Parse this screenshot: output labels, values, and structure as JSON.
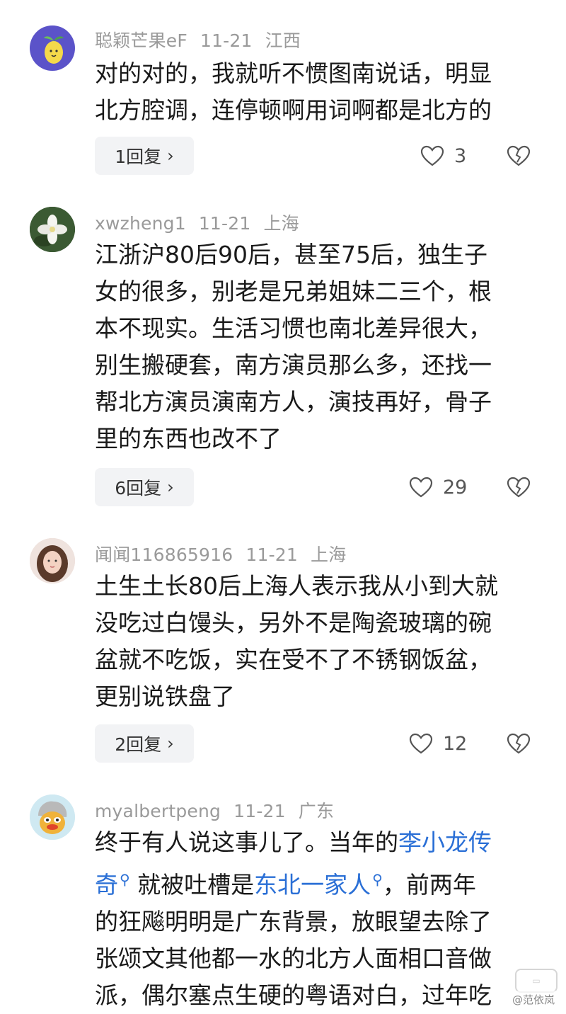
{
  "comments": [
    {
      "username": "聪颖芒果eF",
      "date": "11-21",
      "location": "江西",
      "lines": [
        "对的对的，我就听不惯图南说话，明显",
        "北方腔调，连停顿啊用词啊都是北方的"
      ],
      "reply_label": "1回复",
      "likes": "3"
    },
    {
      "username": "xwzheng1",
      "date": "11-21",
      "location": "上海",
      "lines": [
        "江浙沪80后90后，甚至75后，独生子",
        "女的很多，别老是兄弟姐妹二三个，根",
        "本不现实。生活习惯也南北差异很大，",
        "别生搬硬套，南方演员那么多，还找一",
        "帮北方演员演南方人，演技再好，骨子",
        "里的东西也改不了"
      ],
      "reply_label": "6回复",
      "likes": "29"
    },
    {
      "username": "闻闻116865916",
      "date": "11-21",
      "location": "上海",
      "lines": [
        "土生土长80后上海人表示我从小到大就",
        "没吃过白馒头，另外不是陶瓷玻璃的碗",
        "盆就不吃饭，实在受不了不锈钢饭盆，",
        "更别说铁盘了"
      ],
      "reply_label": "2回复",
      "likes": "12"
    },
    {
      "username": "myalbertpeng",
      "date": "11-21",
      "location": "广东",
      "line1_pre": "终于有人说这事儿了。当年的",
      "link1a": "李小龙传",
      "link1b": "奇",
      "line2_pre": "就被吐槽是",
      "link2": "东北一家人",
      "line2_post": "，前两年",
      "lines_rest": [
        "的狂飚明明是广东背景，放眼望去除了",
        "张颂文其他都一水的北方人面相口音做",
        "派，偶尔塞点生硬的粤语对白，过年吃"
      ]
    }
  ],
  "watermark": "@范依岚",
  "colors": {
    "link": "#2a6fd6",
    "meta": "#9a9a9a",
    "reply_bg": "#f2f3f5"
  }
}
